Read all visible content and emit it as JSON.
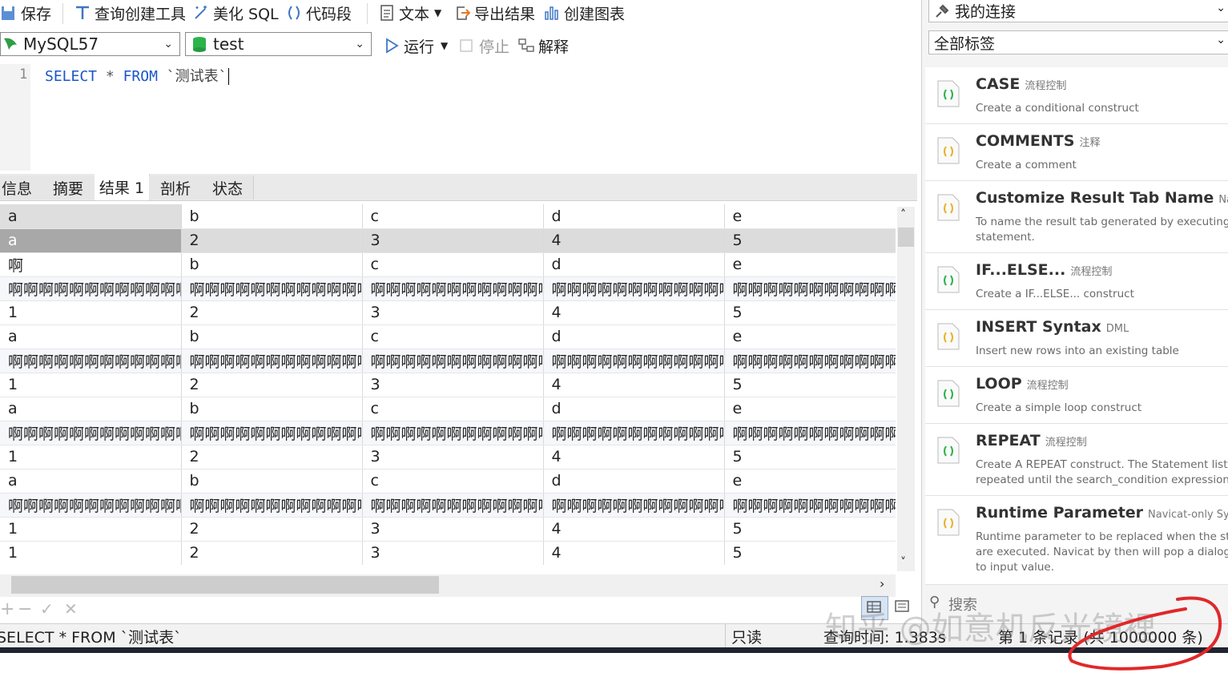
{
  "toolbar": {
    "save": "保存",
    "query_builder": "查询创建工具",
    "beautify": "美化 SQL",
    "snippet": "代码段",
    "text": "文本",
    "export": "导出结果",
    "chart": "创建图表"
  },
  "toolbar2": {
    "connection": "MySQL57",
    "database": "test",
    "run": "运行",
    "stop": "停止",
    "explain": "解释"
  },
  "editor": {
    "line_number": "1",
    "kw_select": "SELECT",
    "star": "*",
    "kw_from": "FROM",
    "table": "`测试表`"
  },
  "result_tabs": [
    "信息",
    "摘要",
    "结果 1",
    "剖析",
    "状态"
  ],
  "grid": {
    "columns": [
      "a",
      "b",
      "c",
      "d",
      "e"
    ],
    "rows": [
      [
        "a",
        "2",
        "3",
        "4",
        "5"
      ],
      [
        "啊",
        "b",
        "c",
        "d",
        "e"
      ],
      [
        "啊啊啊啊啊啊啊啊啊啊啊啊啊",
        "啊啊啊啊啊啊啊啊啊啊啊啊啊",
        "啊啊啊啊啊啊啊啊啊啊啊啊啊",
        "啊啊啊啊啊啊啊啊啊啊啊啊啊",
        "啊啊啊啊啊啊啊啊啊啊啊啊啊"
      ],
      [
        "1",
        "2",
        "3",
        "4",
        "5"
      ],
      [
        "a",
        "b",
        "c",
        "d",
        "e"
      ],
      [
        "啊啊啊啊啊啊啊啊啊啊啊啊啊",
        "啊啊啊啊啊啊啊啊啊啊啊啊啊",
        "啊啊啊啊啊啊啊啊啊啊啊啊啊",
        "啊啊啊啊啊啊啊啊啊啊啊啊啊",
        "啊啊啊啊啊啊啊啊啊啊啊啊啊"
      ],
      [
        "1",
        "2",
        "3",
        "4",
        "5"
      ],
      [
        "a",
        "b",
        "c",
        "d",
        "e"
      ],
      [
        "啊啊啊啊啊啊啊啊啊啊啊啊啊",
        "啊啊啊啊啊啊啊啊啊啊啊啊啊",
        "啊啊啊啊啊啊啊啊啊啊啊啊啊",
        "啊啊啊啊啊啊啊啊啊啊啊啊啊",
        "啊啊啊啊啊啊啊啊啊啊啊啊啊"
      ],
      [
        "1",
        "2",
        "3",
        "4",
        "5"
      ],
      [
        "a",
        "b",
        "c",
        "d",
        "e"
      ],
      [
        "啊啊啊啊啊啊啊啊啊啊啊啊啊",
        "啊啊啊啊啊啊啊啊啊啊啊啊啊",
        "啊啊啊啊啊啊啊啊啊啊啊啊啊",
        "啊啊啊啊啊啊啊啊啊啊啊啊啊",
        "啊啊啊啊啊啊啊啊啊啊啊啊啊"
      ],
      [
        "1",
        "2",
        "3",
        "4",
        "5"
      ],
      [
        "1",
        "2",
        "3",
        "4",
        "5"
      ]
    ]
  },
  "status": {
    "sql": "SELECT * FROM `测试表`",
    "readonly": "只读",
    "query_time": "查询时间: 1.383s",
    "records": "第 1 条记录 (共 1000000 条)"
  },
  "right_panel": {
    "connection_select": "我的连接",
    "tag_select": "全部标签",
    "search_placeholder": "搜索",
    "snippets": [
      {
        "title": "CASE",
        "tag": "流程控制",
        "desc": "Create a conditional construct",
        "color": "green"
      },
      {
        "title": "COMMENTS",
        "tag": "注释",
        "desc": "Create a comment",
        "color": "yellow"
      },
      {
        "title": "Customize Result Tab Name",
        "tag": "Navicat-o",
        "desc": "To name the result tab generated by executing the\nstatement.",
        "color": "yellow"
      },
      {
        "title": "IF...ELSE...",
        "tag": "流程控制",
        "desc": "Create a IF...ELSE... construct",
        "color": "green"
      },
      {
        "title": "INSERT Syntax",
        "tag": "DML",
        "desc": "Insert new rows into an existing table",
        "color": "yellow"
      },
      {
        "title": "LOOP",
        "tag": "流程控制",
        "desc": "Create a simple loop construct",
        "color": "green"
      },
      {
        "title": "REPEAT",
        "tag": "流程控制",
        "desc": "Create A REPEAT construct. The Statement list is\nrepeated until the search_condition expression is tru",
        "color": "green"
      },
      {
        "title": "Runtime Parameter",
        "tag": "Navicat-only Syntax",
        "desc": "Runtime parameter to be replaced when the statem\nare executed. Navicat by then will pop a dialog for y\nto input value.",
        "color": "yellow"
      }
    ]
  },
  "watermark": "知乎 @如意机反光镜裡",
  "colors": {
    "keyword": "#1a56c8",
    "green_icon": "#2db34a",
    "yellow_icon": "#e8b22a",
    "annotation_red": "#e0282a"
  }
}
